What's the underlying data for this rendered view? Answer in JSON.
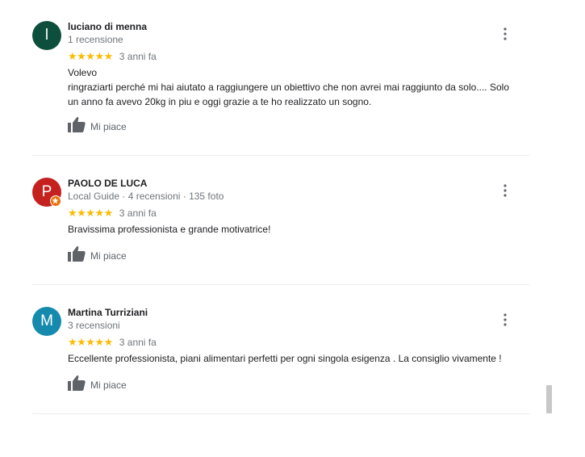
{
  "reviews": [
    {
      "avatar_initial": "l",
      "avatar_color": "#0d4f3c",
      "name": "luciano di menna",
      "meta": "1 recensione",
      "stars": "★★★★★",
      "date": "3 anni fa",
      "text_lines": [
        "Volevo",
        "ringraziarti perché mi hai aiutato a raggiungere un obiettivo che non avrei mai raggiunto da solo.... Solo",
        "un anno fa avevo 20kg in piu e oggi grazie a te ho realizzato un sogno."
      ],
      "like_label": "Mi piace",
      "local_guide": false
    },
    {
      "avatar_initial": "P",
      "avatar_color": "#c5221f",
      "name": "PAOLO DE LUCA",
      "meta": "Local Guide · 4 recensioni · 135 foto",
      "stars": "★★★★★",
      "date": "3 anni fa",
      "text_lines": [
        "Bravissima professionista e grande motivatrice!"
      ],
      "like_label": "Mi piace",
      "local_guide": true
    },
    {
      "avatar_initial": "M",
      "avatar_color": "#168aad",
      "name": "Martina Turriziani",
      "meta": "3 recensioni",
      "stars": "★★★★★",
      "date": "3 anni fa",
      "text_lines": [
        "Eccellente professionista, piani alimentari perfetti per ogni singola esigenza . La consiglio vivamente !"
      ],
      "like_label": "Mi piace",
      "local_guide": false
    }
  ],
  "colors": {
    "star": "#fbbc04",
    "secondary_text": "#70757a",
    "icon": "#5f6368",
    "badge": "#e8710a"
  },
  "icons": {
    "like": "thumb-up-icon",
    "menu": "more-vert-icon",
    "local_guide": "star-badge-icon"
  }
}
